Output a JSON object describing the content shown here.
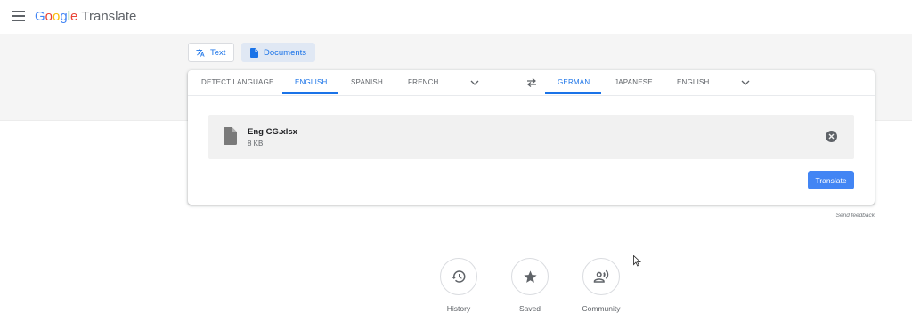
{
  "header": {
    "brand": {
      "G": "G",
      "o1": "o",
      "o2": "o",
      "g": "g",
      "l": "l",
      "e": "e"
    },
    "product": "Translate"
  },
  "mode_tabs": {
    "text": "Text",
    "documents": "Documents"
  },
  "source_languages": [
    "Detect language",
    "English",
    "Spanish",
    "French"
  ],
  "target_languages": [
    "German",
    "Japanese",
    "English"
  ],
  "file": {
    "name": "Eng CG.xlsx",
    "size": "8 KB"
  },
  "translate_label": "Translate",
  "feedback_label": "Send feedback",
  "shortcuts": {
    "history": "History",
    "saved": "Saved",
    "community": "Community"
  },
  "colors": {
    "accent": "#1a73e8",
    "button": "#4285f4",
    "band": "#f5f5f5",
    "tab_active_bg": "#e0e8f4"
  }
}
